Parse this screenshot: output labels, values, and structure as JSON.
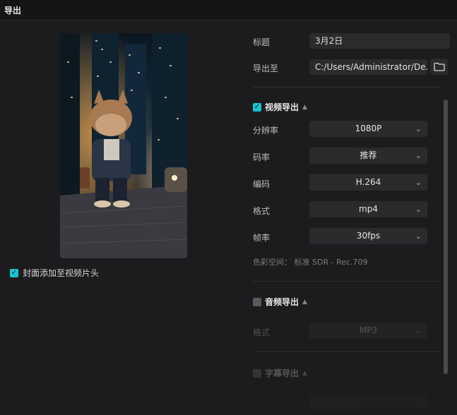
{
  "window": {
    "title": "导出"
  },
  "cover": {
    "label": "封面添加至视频片头",
    "checked": true
  },
  "basic": {
    "title_label": "标题",
    "title_value": "3月2日",
    "export_to_label": "导出至",
    "export_to_value": "C:/Users/Administrator/De..."
  },
  "video": {
    "section_label": "视频导出",
    "checked": true,
    "resolution": {
      "label": "分辨率",
      "value": "1080P"
    },
    "bitrate": {
      "label": "码率",
      "value": "推荐"
    },
    "codec": {
      "label": "编码",
      "value": "H.264"
    },
    "format": {
      "label": "格式",
      "value": "mp4"
    },
    "framerate": {
      "label": "帧率",
      "value": "30fps"
    },
    "color_space": "色彩空间： 标准 SDR - Rec.709"
  },
  "audio": {
    "section_label": "音频导出",
    "checked": false,
    "format": {
      "label": "格式",
      "value": "MP3"
    }
  },
  "subtitle": {
    "section_label": "字幕导出",
    "checked": false
  },
  "colors": {
    "accent": "#19c3d1",
    "background": "#1c1c1e",
    "field": "#2b2b2e"
  }
}
